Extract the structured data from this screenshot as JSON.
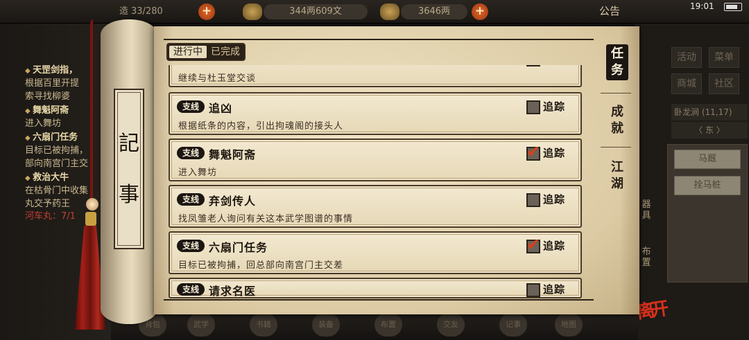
{
  "hud": {
    "partial_left": "造",
    "capacity": "33/280",
    "money": "344两609文",
    "ingots": "3646两",
    "notice": "公告",
    "time": "19:01"
  },
  "bg_quests": [
    {
      "text": "天罡剑指，",
      "type": "head"
    },
    {
      "text": "根据百里开提",
      "type": "line"
    },
    {
      "text": "索寻找柳婆",
      "type": "line"
    },
    {
      "text": "舞魁阿斋",
      "type": "head"
    },
    {
      "text": "进入舞坊",
      "type": "line"
    },
    {
      "text": "六扇门任务",
      "type": "head"
    },
    {
      "text": "目标已被拘捕，",
      "type": "line"
    },
    {
      "text": "部向南宫门主交",
      "type": "line"
    },
    {
      "text": "救治大牛",
      "type": "head"
    },
    {
      "text": "在枯骨门中收集",
      "type": "line"
    },
    {
      "text": "丸交予药王",
      "type": "line"
    },
    {
      "text": "河车丸：7/1",
      "type": "red"
    }
  ],
  "right_menu": {
    "buttons": [
      "活动",
      "菜单",
      "商城",
      "社区"
    ],
    "location": "卧龙涧 (11,17)",
    "direction": "〈 东 〉",
    "actions": [
      "马厩",
      "拴马桩"
    ],
    "side_labels": [
      "器具",
      "布置"
    ]
  },
  "bottom_icons": [
    "背包",
    "武学",
    "书籍",
    "装备",
    "布置",
    "交友",
    "记事",
    "地图"
  ],
  "leave_label": "离开",
  "scroll_title": [
    "記",
    "事"
  ],
  "status_tabs": {
    "active": "进行中",
    "inactive": "已完成"
  },
  "category_tabs": [
    "任务",
    "成就",
    "江湖"
  ],
  "track_label": "追踪",
  "quests": [
    {
      "badge": "",
      "title": "",
      "desc": "继续与杜玉堂交谈",
      "tracked": false
    },
    {
      "badge": "支线",
      "title": "追凶",
      "desc": "根据纸条的内容，引出拘魂阁的接头人",
      "tracked": false
    },
    {
      "badge": "支线",
      "title": "舞魁阿斋",
      "desc": "进入舞坊",
      "tracked": true
    },
    {
      "badge": "支线",
      "title": "弃剑传人",
      "desc": "找凤雏老人询问有关这本武学图谱的事情",
      "tracked": false
    },
    {
      "badge": "支线",
      "title": "六扇门任务",
      "desc": "目标已被拘捕，回总部向南宫门主交差",
      "tracked": true
    },
    {
      "badge": "支线",
      "title": "请求名医",
      "desc": "",
      "tracked": false
    }
  ]
}
